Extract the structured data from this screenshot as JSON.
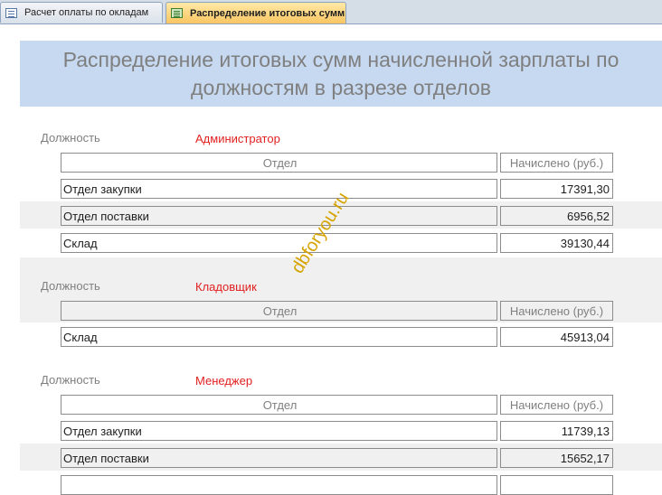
{
  "tabs": [
    {
      "label": "Расчет оплаты по окладам",
      "icon": "report-icon"
    },
    {
      "label": "Распределение итоговых сумм",
      "icon": "form-icon"
    }
  ],
  "report": {
    "title": "Распределение итоговых сумм начисленной зарплаты по должностям в разрезе отделов",
    "position_label": "Должность",
    "col_department": "Отдел",
    "col_amount": "Начислено (руб.)"
  },
  "groups": [
    {
      "position": "Администратор",
      "rows": [
        {
          "department": "Отдел закупки",
          "amount": "17391,30"
        },
        {
          "department": "Отдел поставки",
          "amount": "6956,52"
        },
        {
          "department": "Склад",
          "amount": "39130,44"
        }
      ]
    },
    {
      "position": "Кладовщик",
      "rows": [
        {
          "department": "Склад",
          "amount": "45913,04"
        }
      ]
    },
    {
      "position": "Менеджер",
      "rows": [
        {
          "department": "Отдел закупки",
          "amount": "11739,13"
        },
        {
          "department": "Отдел поставки",
          "amount": "15652,17"
        },
        {
          "department": "",
          "amount": ""
        }
      ]
    }
  ],
  "watermark": "dbforyou.ru",
  "colors": {
    "header_bg": "#c6d9f0",
    "position_value": "#e11f1f",
    "active_tab": "#f9c561",
    "watermark": "#d6a400"
  }
}
